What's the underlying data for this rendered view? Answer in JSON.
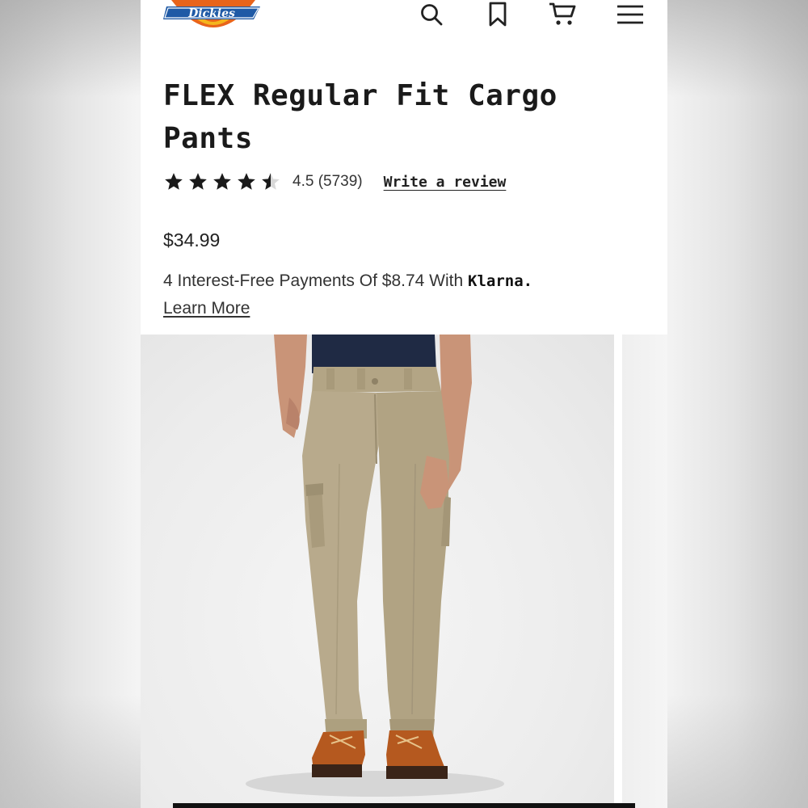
{
  "header": {
    "logo_text": "Dickies",
    "icons": [
      "search-icon",
      "bookmark-icon",
      "cart-icon",
      "menu-icon"
    ]
  },
  "product": {
    "title": "FLEX Regular Fit Cargo Pants",
    "rating": 4.5,
    "rating_text": "4.5 (5739)",
    "write_review_label": "Write a review",
    "price": "$34.99",
    "klarna_text": "4 Interest-Free Payments Of $8.74 With ",
    "klarna_brand": "Klarna.",
    "learn_more_label": "Learn More"
  },
  "colors": {
    "accent_text": "#1a1a1a",
    "logo_blue": "#1f5aa6",
    "logo_orange": "#e8641b",
    "logo_yellow": "#f4b51d",
    "pants_khaki": "#b8aa8c",
    "shirt_navy": "#1f2a44",
    "boot_brown": "#b5591f"
  }
}
